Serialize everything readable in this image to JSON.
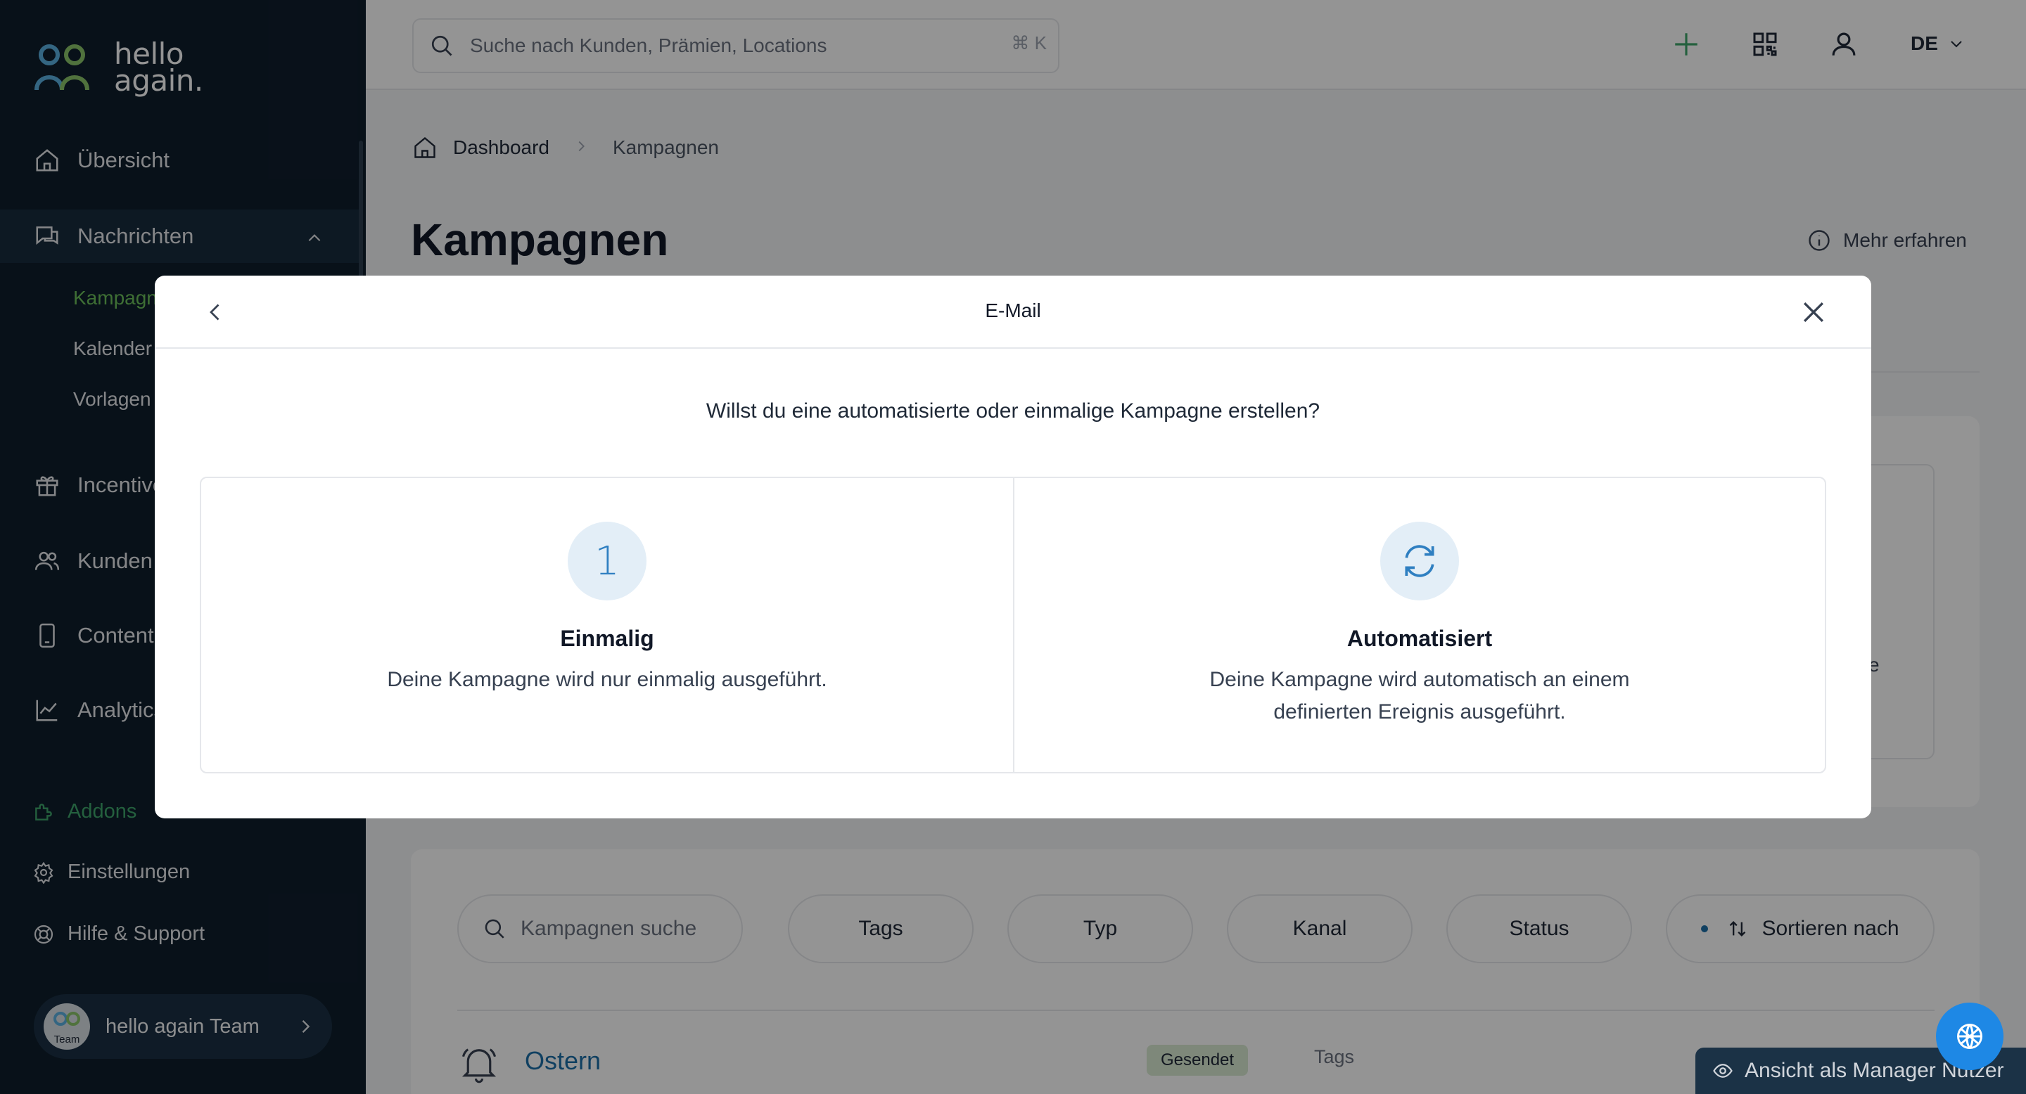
{
  "sidebar": {
    "logo_text_1": "hello",
    "logo_text_2": "again.",
    "overview": "Übersicht",
    "messages": "Nachrichten",
    "sub_campaigns": "Kampagnen",
    "sub_calendar": "Kalender",
    "sub_templates": "Vorlagen",
    "incentives": "Incentives",
    "customers": "Kunden",
    "content": "Content",
    "analytics": "Analytics",
    "addons": "Addons",
    "settings": "Einstellungen",
    "help": "Hilfe & Support",
    "user_name": "hello again Team",
    "avatar_label": "Team"
  },
  "topbar": {
    "search_placeholder": "Suche nach Kunden, Prämien, Locations",
    "shortcut": "⌘ K",
    "language": "DE"
  },
  "breadcrumb": {
    "home": "Dashboard",
    "current": "Kampagnen"
  },
  "page": {
    "title": "Kampagnen",
    "more_info": "Mehr erfahren",
    "card_partial_text": "e"
  },
  "filters": {
    "search_placeholder": "Kampagnen suche",
    "tags": "Tags",
    "type": "Typ",
    "channel": "Kanal",
    "status": "Status",
    "sort": "Sortieren nach"
  },
  "campaign_row": {
    "name": "Ostern",
    "status": "Gesendet",
    "tags": "Tags"
  },
  "manager_view": "Ansicht als Manager Nutzer",
  "modal": {
    "title": "E-Mail",
    "question": "Willst du eine automatisierte oder einmalige Kampagne erstellen?",
    "options": [
      {
        "icon_text": "1",
        "title": "Einmalig",
        "description": "Deine Kampagne wird nur einmalig ausgeführt."
      },
      {
        "icon": "refresh-icon",
        "title": "Automatisiert",
        "description": "Deine Kampagne wird automatisch an einem definierten Ereignis ausgeführt."
      }
    ]
  },
  "colors": {
    "sidebar_bg": "#0f1e2c",
    "accent_green": "#6cbf5a",
    "accent_blue": "#2f7fc1",
    "badge_green": "#d9ead3"
  }
}
